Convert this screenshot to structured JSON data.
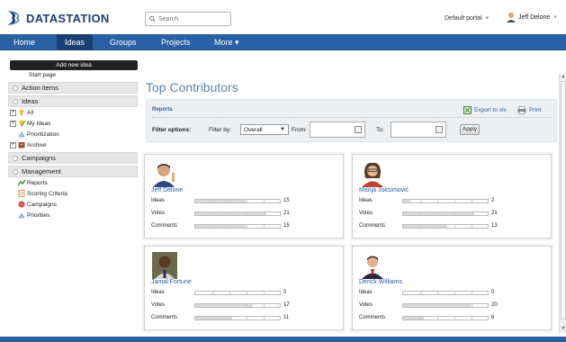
{
  "brand": {
    "name": "DATASTATION"
  },
  "search": {
    "placeholder": "Search"
  },
  "header": {
    "portal_label": "Default portal",
    "user_name": "Jeff Delone"
  },
  "nav": {
    "items": [
      {
        "label": "Home"
      },
      {
        "label": "Ideas"
      },
      {
        "label": "Groups"
      },
      {
        "label": "Projects"
      },
      {
        "label": "More ▾"
      }
    ],
    "active": "Ideas"
  },
  "sidebar": {
    "add_button": "Add new idea",
    "start_page": "Start page",
    "sections": {
      "action_items": "Action items",
      "ideas": "Ideas",
      "campaigns": "Campaigns",
      "management": "Management"
    },
    "ideas_items": [
      {
        "label": "All",
        "icon": "lightbulb-icon"
      },
      {
        "label": "My Ideas",
        "icon": "lightbulb-icon"
      },
      {
        "label": "Prioritization",
        "icon": "prioritization-icon"
      },
      {
        "label": "Archive",
        "icon": "archive-icon"
      }
    ],
    "management_items": [
      {
        "label": "Reports",
        "icon": "reports-icon"
      },
      {
        "label": "Scoring Criteria",
        "icon": "scoring-icon"
      },
      {
        "label": "Campaigns",
        "icon": "campaigns-icon"
      },
      {
        "label": "Priorities",
        "icon": "priorities-icon"
      }
    ]
  },
  "main": {
    "title": "Top Contributors",
    "reports_label": "Reports",
    "export_label": "Export to xls",
    "print_label": "Print",
    "filter": {
      "options_label": "Filter options:",
      "filter_by_label": "Filter by:",
      "filter_by_value": "Overall",
      "from_label": "From:",
      "to_label": "To:",
      "apply_label": "Apply"
    }
  },
  "stat_labels": {
    "ideas": "Ideas",
    "votes": "Votes",
    "comments": "Comments"
  },
  "contributors": [
    {
      "name": "Jeff Delone",
      "ideas": 15,
      "votes": 21,
      "comments": 15
    },
    {
      "name": "Marija Joksimović",
      "ideas": 2,
      "votes": 21,
      "comments": 13
    },
    {
      "name": "Jamal Fortune",
      "ideas": 0,
      "votes": 17,
      "comments": 11
    },
    {
      "name": "Derick Williams",
      "ideas": 0,
      "votes": 20,
      "comments": 6
    }
  ],
  "colors": {
    "nav_bg": "#2a60a4",
    "nav_active": "#1a3f72",
    "title": "#5a86b6",
    "link": "#2a60a4"
  }
}
